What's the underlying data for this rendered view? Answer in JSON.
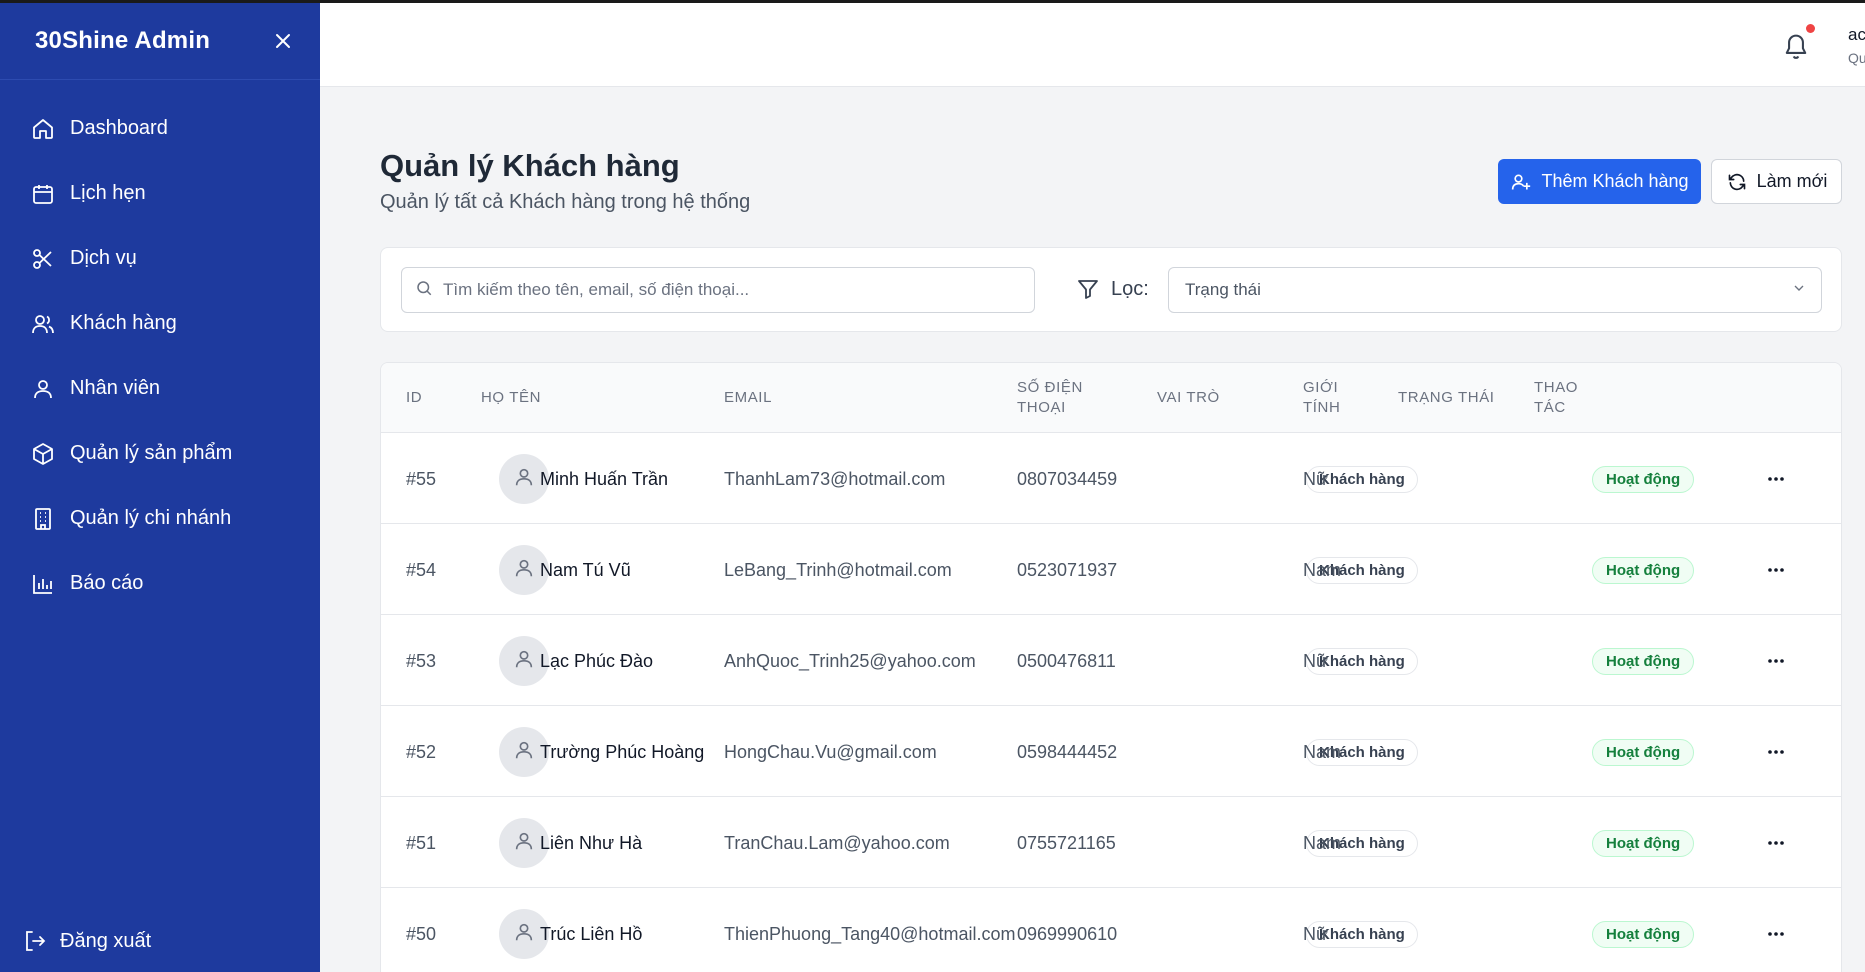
{
  "sidebar": {
    "brand": "30Shine Admin",
    "items": [
      {
        "label": "Dashboard",
        "icon": "home-icon"
      },
      {
        "label": "Lịch hẹn",
        "icon": "calendar-icon"
      },
      {
        "label": "Dịch vụ",
        "icon": "scissors-icon"
      },
      {
        "label": "Khách hàng",
        "icon": "users-icon"
      },
      {
        "label": "Nhân viên",
        "icon": "user-icon"
      },
      {
        "label": "Quản lý sản phẩm",
        "icon": "box-icon"
      },
      {
        "label": "Quản lý chi nhánh",
        "icon": "building-icon"
      },
      {
        "label": "Báo cáo",
        "icon": "bar-chart-icon"
      }
    ],
    "logout_label": "Đăng xuất"
  },
  "topbar": {
    "user_name": "ac",
    "user_role": "Qu"
  },
  "header": {
    "title": "Quản lý Khách hàng",
    "subtitle": "Quản lý tất cả Khách hàng trong hệ thống",
    "add_label": "Thêm Khách hàng",
    "refresh_label": "Làm mới"
  },
  "filter": {
    "search_placeholder": "Tìm kiếm theo tên, email, số điện thoại...",
    "filter_label": "Lọc:",
    "status_select": "Trạng thái"
  },
  "table": {
    "headers": {
      "id": "ID",
      "name": "HỌ TÊN",
      "email": "EMAIL",
      "phone_1": "SỐ ĐIỆN",
      "phone_2": "THOẠI",
      "role": "VAI TRÒ",
      "gender_1": "GIỚI",
      "gender_2": "TÍNH",
      "status": "TRẠNG THÁI",
      "actions_1": "THAO",
      "actions_2": "TÁC"
    },
    "rows": [
      {
        "id": "#55",
        "name": "Minh Huấn Trần",
        "email": "ThanhLam73@hotmail.com",
        "phone": "0807034459",
        "role": "Khách hàng",
        "gender": "Nữ",
        "status": "Hoạt động"
      },
      {
        "id": "#54",
        "name": "Nam Tú Vũ",
        "email": "LeBang_Trinh@hotmail.com",
        "phone": "0523071937",
        "role": "Khách hàng",
        "gender": "Nam",
        "status": "Hoạt động"
      },
      {
        "id": "#53",
        "name": "Lạc Phúc Đào",
        "email": "AnhQuoc_Trinh25@yahoo.com",
        "phone": "0500476811",
        "role": "Khách hàng",
        "gender": "Nữ",
        "status": "Hoạt động"
      },
      {
        "id": "#52",
        "name": "Trường Phúc Hoàng",
        "email": "HongChau.Vu@gmail.com",
        "phone": "0598444452",
        "role": "Khách hàng",
        "gender": "Nam",
        "status": "Hoạt động"
      },
      {
        "id": "#51",
        "name": "Liên Như Hà",
        "email": "TranChau.Lam@yahoo.com",
        "phone": "0755721165",
        "role": "Khách hàng",
        "gender": "Nam",
        "status": "Hoạt động"
      },
      {
        "id": "#50",
        "name": "Trúc Liên Hồ",
        "email": "ThienPhuong_Tang40@hotmail.com",
        "phone": "0969990610",
        "role": "Khách hàng",
        "gender": "Nữ",
        "status": "Hoạt động"
      }
    ]
  },
  "colors": {
    "sidebar_bg": "#1e3a9e",
    "primary": "#2563eb",
    "status_green": "#15803d",
    "notification_dot": "#ef4444"
  }
}
